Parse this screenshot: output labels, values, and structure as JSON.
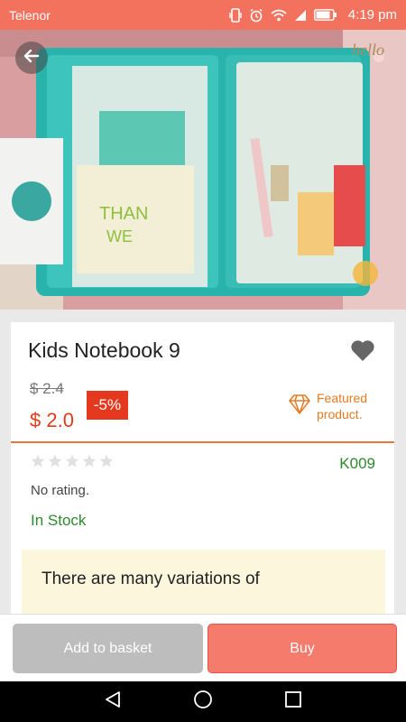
{
  "status_bar": {
    "carrier": "Telenor",
    "battery_level": 0.85,
    "time": "4:19 pm",
    "icons": [
      "vibrate-icon",
      "alarm-icon",
      "wifi-icon",
      "signal-icon",
      "battery-icon"
    ]
  },
  "hero": {
    "back_icon": "arrow-left-icon",
    "image": "notebook-photo"
  },
  "product": {
    "title": "Kids Notebook 9",
    "favorite_icon": "heart-icon",
    "old_price": "$ 2.4",
    "price": "$ 2.0",
    "discount": "-5%",
    "featured_icon": "diamond-icon",
    "featured_label": "Featured product.",
    "rating_stars": 0,
    "rating_max": 5,
    "sku": "K009",
    "rating_text": "No rating.",
    "stock": "In Stock",
    "description": "There are many variations of"
  },
  "actions": {
    "basket_label": "Add to basket",
    "buy_label": "Buy"
  },
  "nav_bar": {
    "icons": [
      "back-triangle-icon",
      "home-circle-icon",
      "recents-square-icon"
    ]
  },
  "colors": {
    "accent": "#f2725e",
    "price": "#e03a1e",
    "featured": "#e67a23",
    "stock": "#2d8a2d",
    "buy_button": "#f57b6c",
    "basket_button": "#bdbdbd"
  }
}
